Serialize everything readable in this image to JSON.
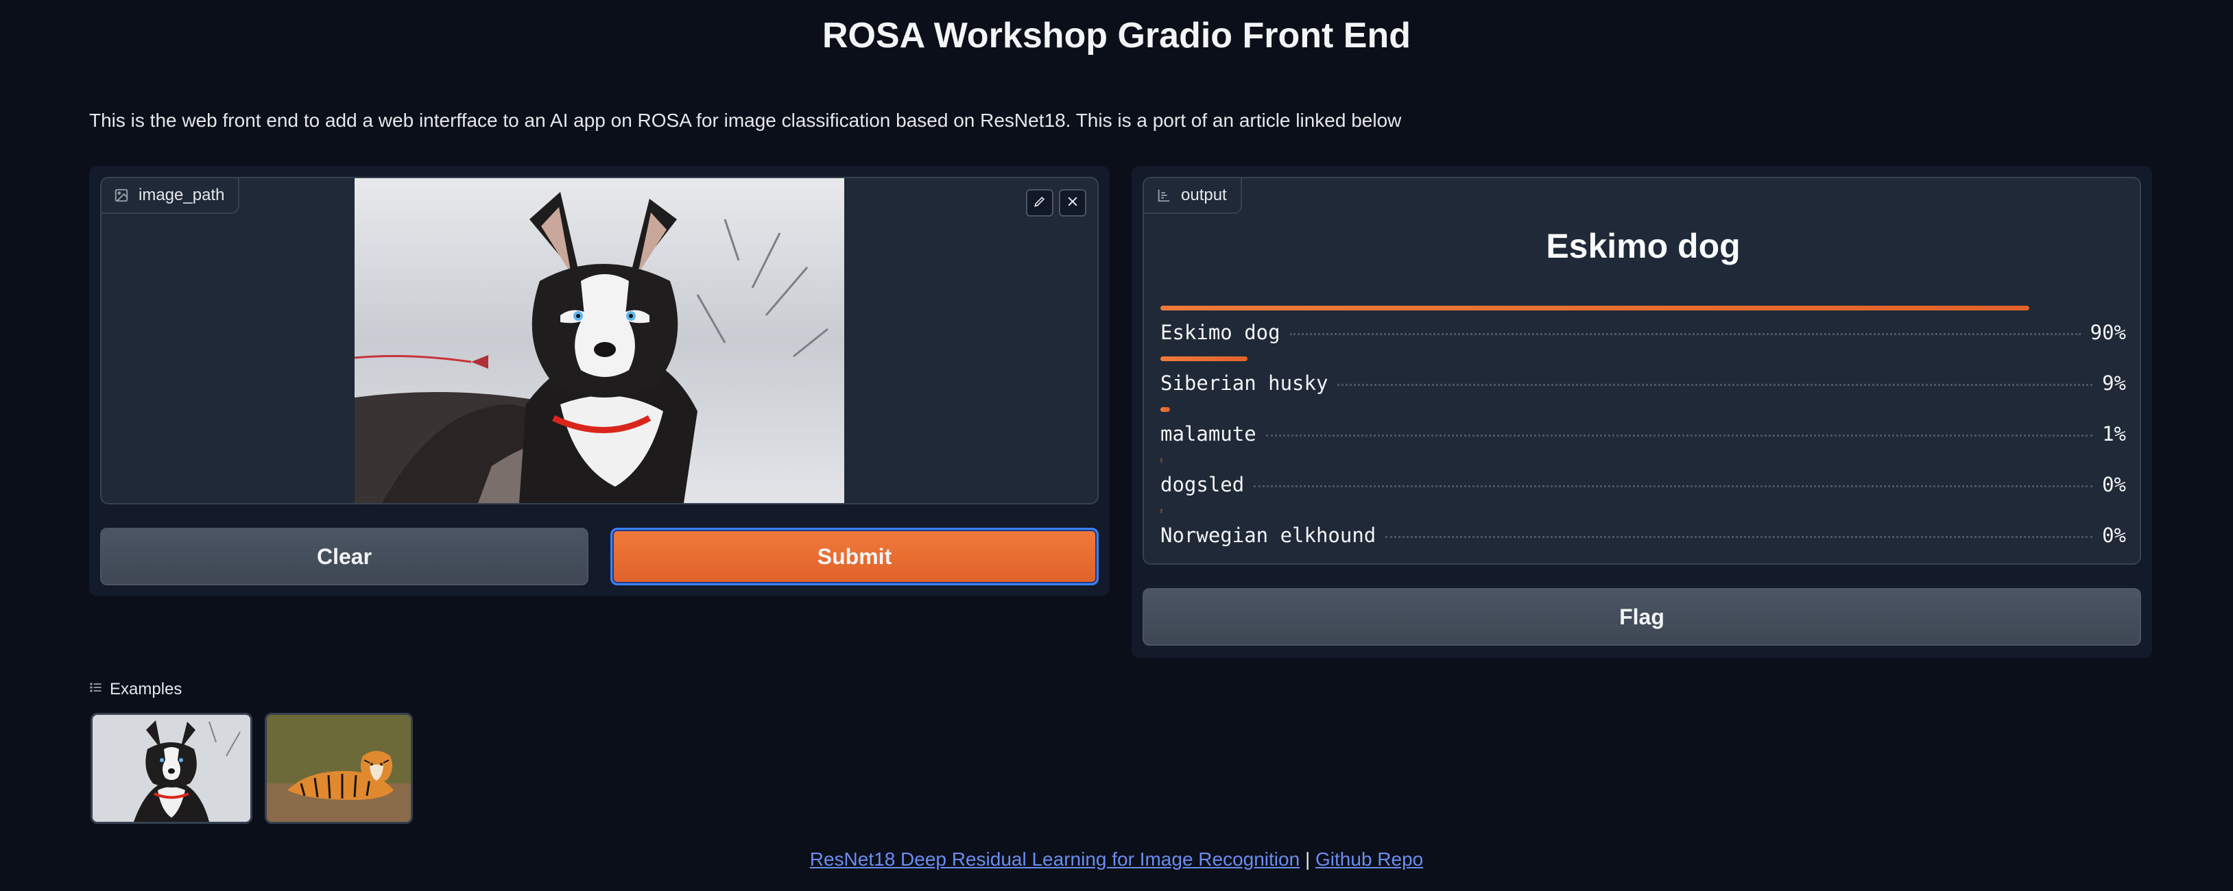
{
  "header": {
    "title": "ROSA Workshop Gradio Front End",
    "description": "This is the web front end to add a web interfface to an AI app on ROSA for image classification based on ResNet18. This is a port of an article linked below"
  },
  "input": {
    "label": "image_path",
    "label_icon": "image-icon",
    "edit_icon": "pencil-icon",
    "close_icon": "close-icon"
  },
  "buttons": {
    "clear": "Clear",
    "submit": "Submit",
    "flag": "Flag"
  },
  "output": {
    "label": "output",
    "label_icon": "bar-chart-icon",
    "top_label": "Eskimo dog",
    "confidences": [
      {
        "label": "Eskimo dog",
        "display": "90%",
        "value": 0.9
      },
      {
        "label": "Siberian husky",
        "display": "9%",
        "value": 0.09
      },
      {
        "label": "malamute",
        "display": "1%",
        "value": 0.01
      },
      {
        "label": "dogsled",
        "display": "0%",
        "value": 0.0
      },
      {
        "label": "Norwegian elkhound",
        "display": "0%",
        "value": 0.0
      }
    ]
  },
  "examples": {
    "label": "Examples",
    "items": [
      "husky-thumbnail",
      "tiger-thumbnail"
    ]
  },
  "footer": {
    "link1": "ResNet18 Deep Residual Learning for Image Recognition",
    "separator": "|",
    "link2": "Github Repo"
  },
  "colors": {
    "background": "#0b0f19",
    "panel": "#131a29",
    "accent": "#e8692f",
    "link": "#6b8df0"
  }
}
